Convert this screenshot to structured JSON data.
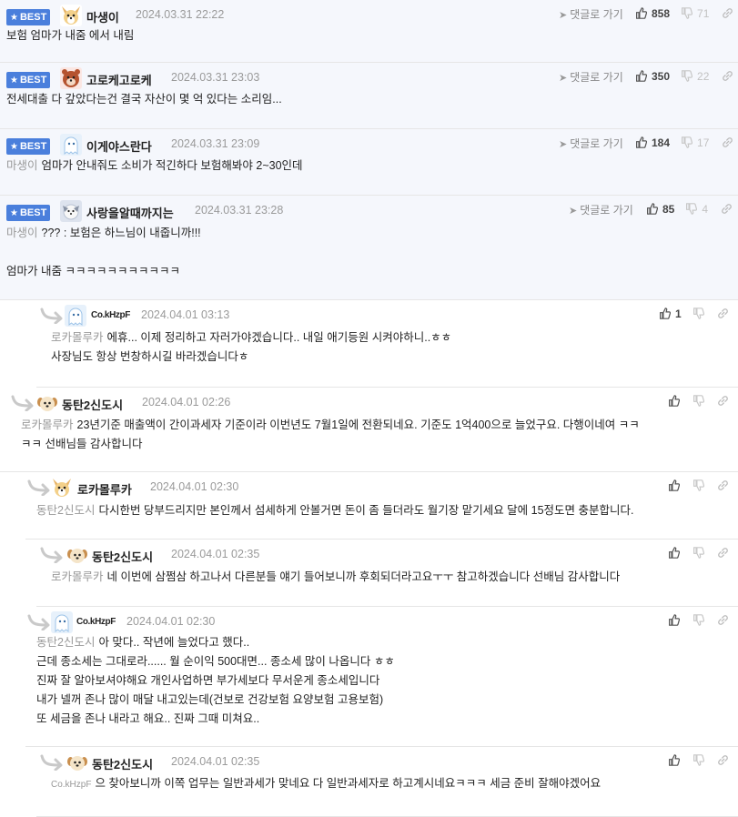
{
  "labels": {
    "best": "BEST",
    "goto": "댓글로 가기"
  },
  "colors": {
    "best_badge": "#4a7fdc",
    "best_bg": "#f5f7fc",
    "mention": "#999999",
    "date": "#9a9a9a"
  },
  "comments": [
    {
      "best": true,
      "nick": "마생이",
      "avatar": "dog-face-avatar",
      "date": "2024.03.31 22:22",
      "up": "858",
      "down": "71",
      "lines": [
        {
          "text": "보험 엄마가 내줌 에서 내림"
        }
      ]
    },
    {
      "best": true,
      "nick": "고로케고로케",
      "avatar": "bear-avatar",
      "date": "2024.03.31 23:03",
      "up": "350",
      "down": "22",
      "lines": [
        {
          "text": "전세대출 다 갚았다는건 결국 자산이 몇 억 있다는 소리임..."
        }
      ]
    },
    {
      "best": true,
      "nick": "이게야스란다",
      "avatar": "ghost-avatar",
      "date": "2024.03.31 23:09",
      "up": "184",
      "down": "17",
      "lines": [
        {
          "mention": "마생이",
          "text": "엄마가 안내줘도 소비가 적긴하다 보험해봐야 2~30인데"
        }
      ]
    },
    {
      "best": true,
      "nick": "사랑을알때까지는",
      "avatar": "snow-dog-avatar",
      "date": "2024.03.31 23:28",
      "up": "85",
      "down": "4",
      "lines": [
        {
          "mention": "마생이",
          "text": "??? : 보험은 하느님이 내줍니까!!!"
        },
        {
          "text": ""
        },
        {
          "text": "엄마가 내줌 ㅋㅋㅋㅋㅋㅋㅋㅋㅋㅋㅋ"
        }
      ]
    },
    {
      "best": false,
      "nick": "Co.kHzpF",
      "avatar": "ghost-avatar",
      "date": "2024.04.01 03:13",
      "up": "1",
      "down": "",
      "lines": [
        {
          "mention": "로카몰루카",
          "text": "에휴... 이제 정리하고 자러가야겠습니다.. 내일 애기등원 시켜야하니..ㅎㅎ"
        },
        {
          "text": "사장님도 항상 번창하시길 바라겠습니다ㅎ"
        }
      ]
    },
    {
      "best": false,
      "nick": "동탄2신도시",
      "avatar": "puppy-avatar",
      "date": "2024.04.01 02:26",
      "up": "",
      "down": "",
      "lines": [
        {
          "mention": "로카몰루카",
          "text": "23년기준 매출액이 간이과세자 기준이라 이번년도 7월1일에 전환되네요. 기준도 1억400으로 늘었구요. 다행이네여 ㅋㅋ"
        },
        {
          "text": "ㅋㅋ 선배님들 감사합니다"
        }
      ]
    },
    {
      "best": false,
      "nick": "로카몰루카",
      "avatar": "dog-face-avatar",
      "date": "2024.04.01 02:30",
      "up": "",
      "down": "",
      "lines": [
        {
          "mention": "동탄2신도시",
          "text": "다시한번 당부드리지만 본인께서 섬세하게 안볼거면 돈이 좀 들더라도 월기장 맡기세요 달에 15정도면 충분합니다."
        }
      ]
    },
    {
      "best": false,
      "nick": "동탄2신도시",
      "avatar": "puppy-avatar",
      "date": "2024.04.01 02:35",
      "up": "",
      "down": "",
      "lines": [
        {
          "mention": "로카몰루카",
          "text": "네 이번에 삼쩜삼 하고나서 다른분들 얘기 들어보니까 후회되더라고요ㅜㅜ 참고하겠습니다 선배님 감사합니다"
        }
      ]
    },
    {
      "best": false,
      "nick": "Co.kHzpF",
      "avatar": "ghost-avatar",
      "date": "2024.04.01 02:30",
      "up": "",
      "down": "",
      "lines": [
        {
          "mention": "동탄2신도시",
          "text": "아 맞다.. 작년에 늘었다고 했다.."
        },
        {
          "text": "근데 종소세는 그대로라...... 월 순이익 500대면... 종소세 많이 나옵니다 ㅎㅎ"
        },
        {
          "text": "진짜 잘 알아보셔야해요 개인사업하면 부가세보다 무서운게 종소세입니다"
        },
        {
          "text": "내가 넬꺼 존나 많이 매달 내고있는데(건보로 건강보험 요양보험 고용보험)"
        },
        {
          "text": "또 세금을 존나 내라고 해요.. 진짜 그때 미쳐요.."
        }
      ]
    },
    {
      "best": false,
      "nick": "동탄2신도시",
      "avatar": "puppy-avatar",
      "date": "2024.04.01 02:35",
      "up": "",
      "down": "",
      "lines": [
        {
          "mention": "Co.kHzpF",
          "text": "으 찾아보니까 이쪽 업무는 일반과세가 맞네요 다 일반과세자로 하고계시네요ㅋㅋㅋ 세금 준비 잘해야겠어요"
        }
      ]
    }
  ]
}
